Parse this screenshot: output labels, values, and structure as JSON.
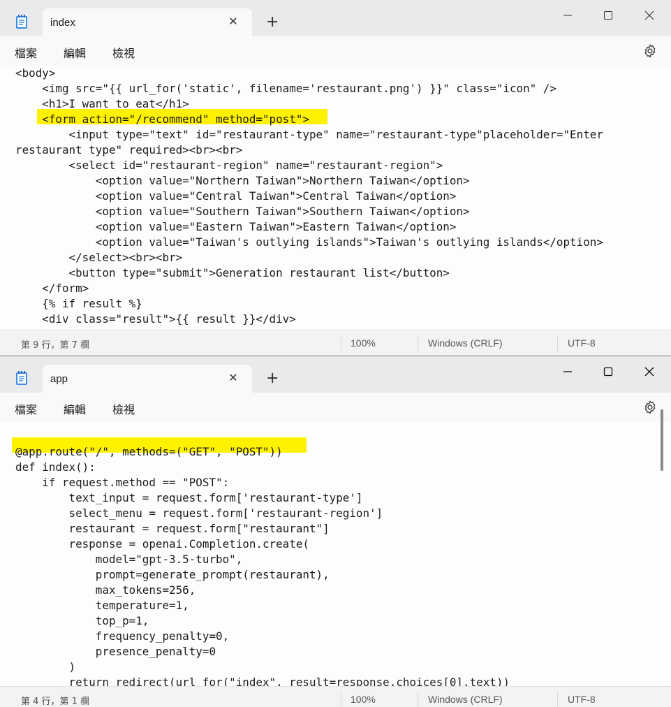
{
  "windows": [
    {
      "tab_title": "index",
      "menu": [
        "檔案",
        "編輯",
        "檢視"
      ],
      "code_lines": [
        "<body>",
        "    <img src=\"{{ url_for('static', filename='restaurant.png') }}\" class=\"icon\" />",
        "    <h1>I want to eat</h1>",
        "    <form action=\"/recommend\" method=\"post\">",
        "        <input type=\"text\" id=\"restaurant-type\" name=\"restaurant-type\"placeholder=\"Enter",
        "restaurant type\" required><br><br>",
        "        <select id=\"restaurant-region\" name=\"restaurant-region\">",
        "            <option value=\"Northern Taiwan\">Northern Taiwan</option>",
        "            <option value=\"Central Taiwan\">Central Taiwan</option>",
        "            <option value=\"Southern Taiwan\">Southern Taiwan</option>",
        "            <option value=\"Eastern Taiwan\">Eastern Taiwan</option>",
        "            <option value=\"Taiwan's outlying islands\">Taiwan's outlying islands</option>",
        "        </select><br><br>",
        "        <button type=\"submit\">Generation restaurant list</button>",
        "    </form>",
        "    {% if result %}",
        "    <div class=\"result\">{{ result }}</div>"
      ],
      "status": {
        "position": "第 9 行，第 7 欄",
        "zoom": "100%",
        "line_ending": "Windows (CRLF)",
        "encoding": "UTF-8"
      }
    },
    {
      "tab_title": "app",
      "menu": [
        "檔案",
        "編輯",
        "檢視"
      ],
      "code_lines": [
        "",
        "@app.route(\"/\", methods=(\"GET\", \"POST\"))",
        "def index():",
        "    if request.method == \"POST\":",
        "        text_input = request.form['restaurant-type']",
        "        select_menu = request.form['restaurant-region']",
        "        restaurant = request.form[\"restaurant\"]",
        "        response = openai.Completion.create(",
        "            model=\"gpt-3.5-turbo\",",
        "            prompt=generate_prompt(restaurant),",
        "            max_tokens=256,",
        "            temperature=1,",
        "            top_p=1,",
        "            frequency_penalty=0,",
        "            presence_penalty=0",
        "        )",
        "        return redirect(url_for(\"index\", result=response.choices[0].text))"
      ],
      "status": {
        "position": "第 4 行，第 1 欄",
        "zoom": "100%",
        "line_ending": "Windows (CRLF)",
        "encoding": "UTF-8"
      }
    }
  ],
  "icons": {
    "app": "notepad-icon",
    "close_tab": "close-icon",
    "new_tab": "plus-icon",
    "settings": "gear-icon",
    "minimize": "minimize-icon",
    "maximize": "maximize-icon",
    "close_window": "close-window-icon"
  },
  "colors": {
    "highlight": "#fff200",
    "titlebar": "#e9eaec",
    "editor": "#fdfdfd"
  }
}
